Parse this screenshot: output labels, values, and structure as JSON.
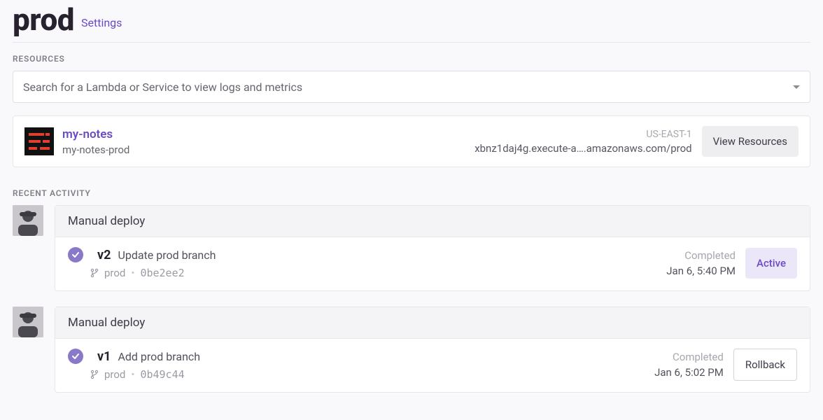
{
  "header": {
    "title": "prod",
    "settings_label": "Settings"
  },
  "sections": {
    "resources_label": "RESOURCES",
    "activity_label": "RECENT ACTIVITY"
  },
  "search": {
    "placeholder": "Search for a Lambda or Service to view logs and metrics"
  },
  "resource": {
    "name": "my-notes",
    "slug": "my-notes-prod",
    "region": "US-EAST-1",
    "endpoint": "xbnz1daj4g.execute-a….amazonaws.com/prod",
    "view_btn": "View Resources"
  },
  "activities": [
    {
      "title": "Manual deploy",
      "version": "v2",
      "msg": "Update prod branch",
      "branch": "prod",
      "hash": "0be2ee2",
      "status": "Completed",
      "timestamp": "Jan 6, 5:40 PM",
      "action_label": "Active",
      "action_type": "active"
    },
    {
      "title": "Manual deploy",
      "version": "v1",
      "msg": "Add prod branch",
      "branch": "prod",
      "hash": "0b49c44",
      "status": "Completed",
      "timestamp": "Jan 6, 5:02 PM",
      "action_label": "Rollback",
      "action_type": "rollback"
    }
  ]
}
